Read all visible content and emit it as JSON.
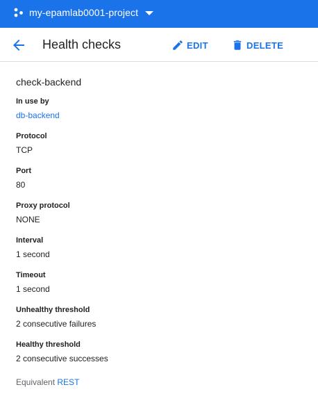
{
  "topbar": {
    "project_name": "my-epamlab0001-project",
    "icons": {
      "project": "project-dots-icon",
      "dropdown": "caret-down-icon"
    },
    "background": "#1a73e8"
  },
  "header": {
    "title": "Health checks",
    "edit_label": "EDIT",
    "delete_label": "DELETE",
    "icons": {
      "back": "arrow-back-icon",
      "edit": "pencil-icon",
      "delete": "trash-icon"
    },
    "accent": "#1a73e8"
  },
  "detail": {
    "name": "check-backend",
    "fields": [
      {
        "label": "In use by",
        "value": "db-backend"
      },
      {
        "label": "Protocol",
        "value": "TCP"
      },
      {
        "label": "Port",
        "value": "80"
      },
      {
        "label": "Proxy protocol",
        "value": "NONE"
      },
      {
        "label": "Interval",
        "value": "1 second"
      },
      {
        "label": "Timeout",
        "value": "1 second"
      },
      {
        "label": "Unhealthy threshold",
        "value": "2 consecutive failures"
      },
      {
        "label": "Healthy threshold",
        "value": "2 consecutive successes"
      }
    ]
  },
  "footer": {
    "equivalent_label": "Equivalent",
    "rest_label": "REST"
  }
}
